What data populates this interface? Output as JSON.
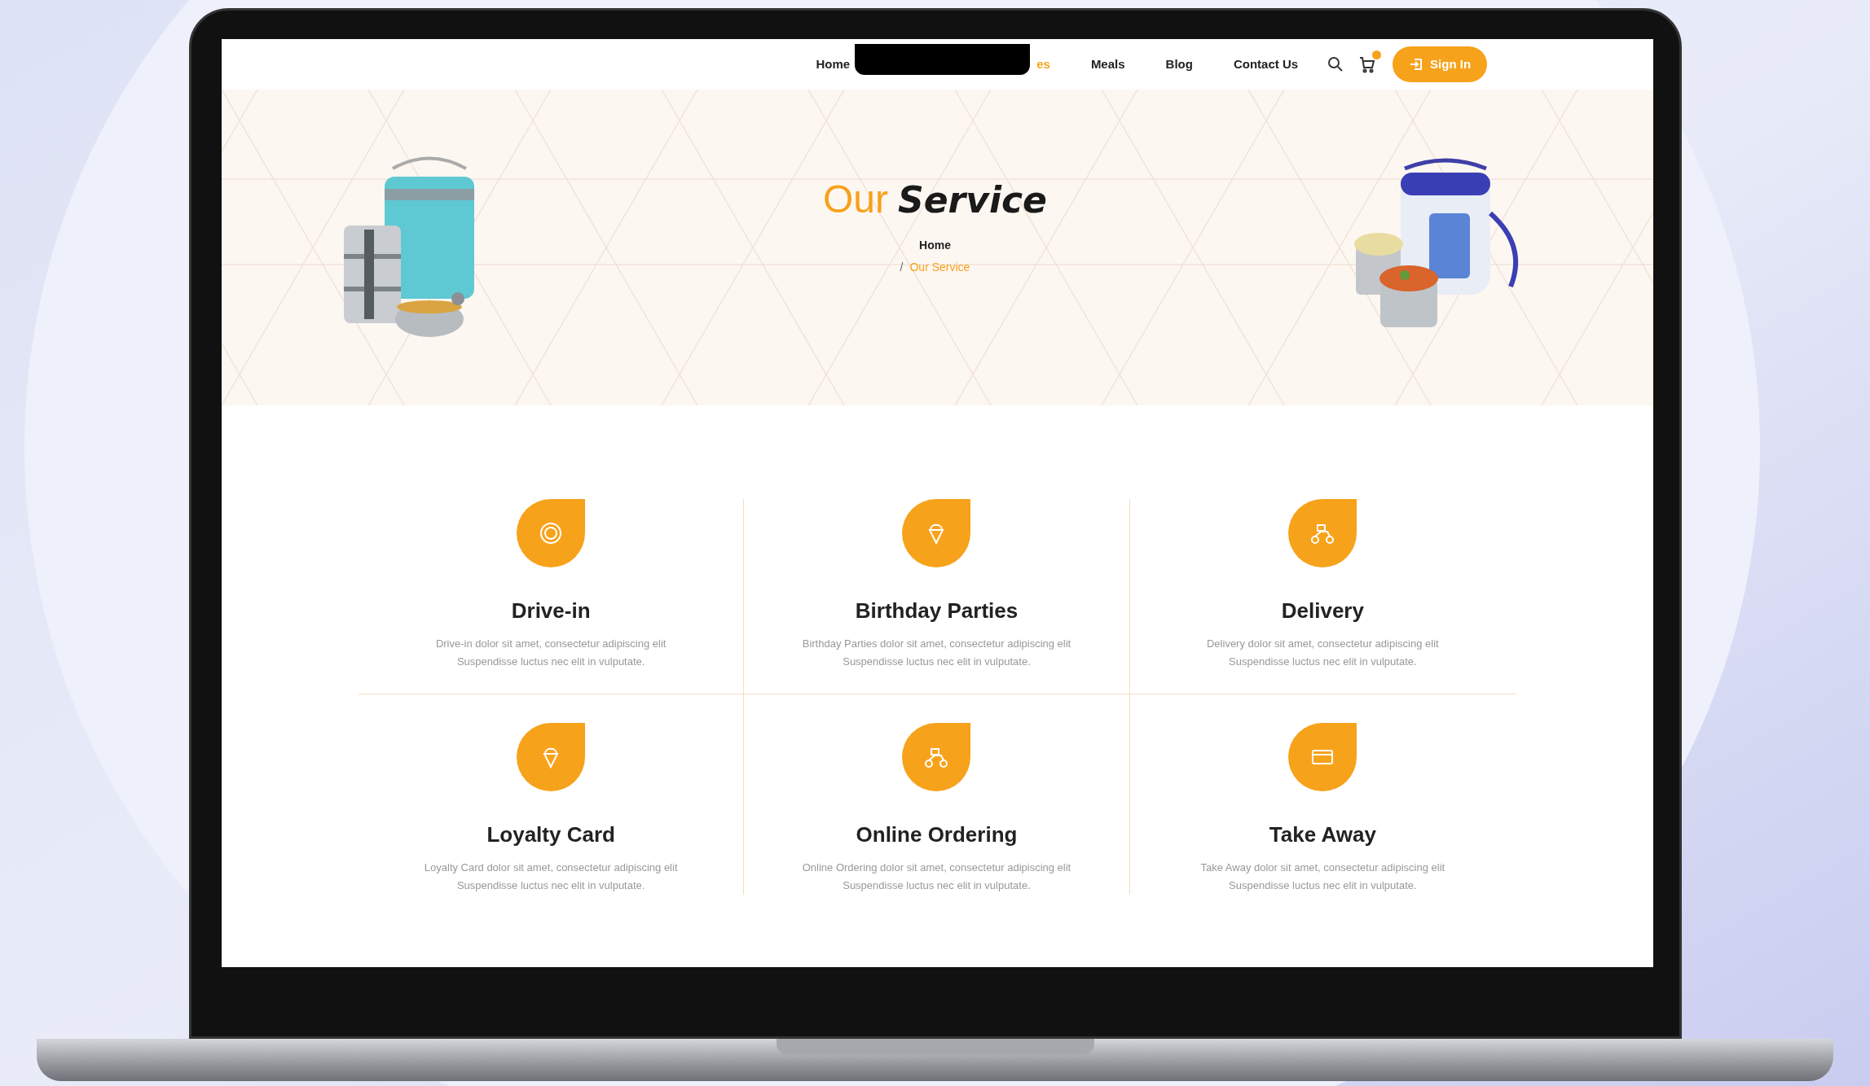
{
  "nav": {
    "items": [
      {
        "label": "Home",
        "selected": false
      },
      {
        "label": "es",
        "selected": true
      },
      {
        "label": "Meals",
        "selected": false
      },
      {
        "label": "Blog",
        "selected": false
      },
      {
        "label": "Contact Us",
        "selected": false
      }
    ],
    "sign_in": "Sign In"
  },
  "hero": {
    "title_plain": "Our",
    "title_script": "Service",
    "breadcrumb": [
      {
        "label": "Home",
        "selected": false
      },
      {
        "label": "Our Service",
        "selected": true
      }
    ],
    "separator": "/"
  },
  "services": [
    {
      "title": "Drive-in",
      "desc": "Drive-in dolor sit amet, consectetur adipiscing elit",
      "desc2": "Suspendisse luctus nec elit in vulputate."
    },
    {
      "title": "Birthday Parties",
      "desc": "Birthday Parties dolor sit amet, consectetur adipiscing elit",
      "desc2": "Suspendisse luctus nec elit in vulputate."
    },
    {
      "title": "Delivery",
      "desc": "Delivery dolor sit amet, consectetur adipiscing elit",
      "desc2": "Suspendisse luctus nec elit in vulputate."
    },
    {
      "title": "Loyalty Card",
      "desc": "Loyalty Card dolor sit amet, consectetur adipiscing elit",
      "desc2": "Suspendisse luctus nec elit in vulputate."
    },
    {
      "title": "Online Ordering",
      "desc": "Online Ordering dolor sit amet, consectetur adipiscing elit",
      "desc2": "Suspendisse luctus nec elit in vulputate."
    },
    {
      "title": "Take Away",
      "desc": "Take Away dolor sit amet, consectetur adipiscing elit",
      "desc2": "Suspendisse luctus nec elit in vulputate."
    }
  ]
}
